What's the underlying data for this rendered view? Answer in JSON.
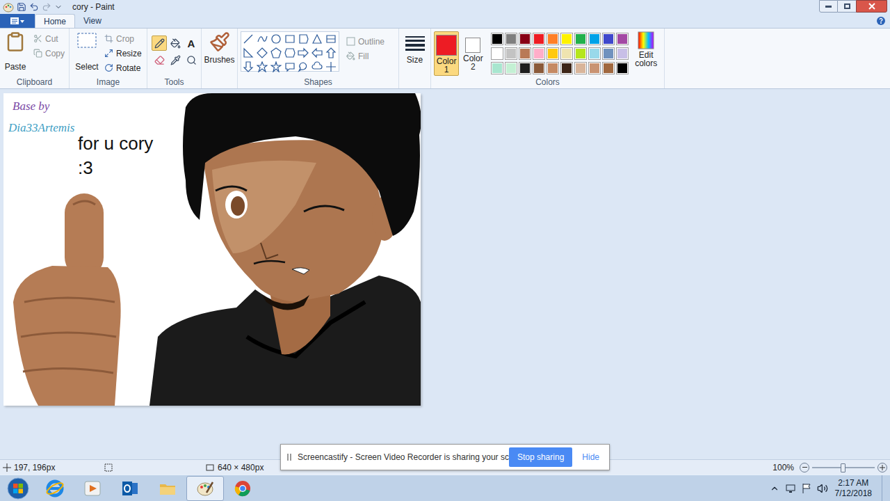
{
  "window": {
    "title": "cory - Paint"
  },
  "tabs": [
    {
      "label": "Home",
      "selected": true
    },
    {
      "label": "View",
      "selected": false
    }
  ],
  "ribbon": {
    "clipboard": {
      "label": "Clipboard",
      "paste": {
        "label": "Paste",
        "disabled": false
      },
      "cut": {
        "label": "Cut",
        "disabled": true
      },
      "copy": {
        "label": "Copy",
        "disabled": true
      }
    },
    "image": {
      "label": "Image",
      "select": {
        "label": "Select",
        "disabled": false
      },
      "crop": {
        "label": "Crop",
        "disabled": true
      },
      "resize": {
        "label": "Resize",
        "disabled": false
      },
      "rotate": {
        "label": "Rotate",
        "disabled": false
      }
    },
    "tools": {
      "label": "Tools",
      "items": [
        {
          "kind": "pencil",
          "selected": true
        },
        {
          "kind": "fill",
          "selected": false
        },
        {
          "kind": "text",
          "glyph": "A",
          "selected": false
        },
        {
          "kind": "eraser",
          "selected": false
        },
        {
          "kind": "picker",
          "selected": false
        },
        {
          "kind": "magnifier",
          "selected": false
        }
      ]
    },
    "brushes": {
      "label": "Brushes"
    },
    "shapes": {
      "label": "Shapes",
      "outline": {
        "label": "Outline",
        "disabled": true
      },
      "fill": {
        "label": "Fill",
        "disabled": true
      }
    },
    "size": {
      "label": "Size"
    },
    "color1": {
      "label": "Color 1",
      "color": "#ed1c24",
      "selected": true
    },
    "color2": {
      "label": "Color 2",
      "color": "#ffffff",
      "selected": false
    },
    "colors": {
      "label": "Colors",
      "swatches": [
        {
          "color": "#000000"
        },
        {
          "color": "#7f7f7f"
        },
        {
          "color": "#880015"
        },
        {
          "color": "#ed1c24"
        },
        {
          "color": "#ff7f27"
        },
        {
          "color": "#fff200"
        },
        {
          "color": "#22b14c"
        },
        {
          "color": "#00a2e8"
        },
        {
          "color": "#3f48cc"
        },
        {
          "color": "#a349a4"
        },
        {
          "color": "#ffffff"
        },
        {
          "color": "#c3c3c3"
        },
        {
          "color": "#b97a57"
        },
        {
          "color": "#ffaec9"
        },
        {
          "color": "#ffc90e"
        },
        {
          "color": "#efe4b0"
        },
        {
          "color": "#b5e61d"
        },
        {
          "color": "#99d9ea"
        },
        {
          "color": "#7092be"
        },
        {
          "color": "#c8bfe7"
        },
        {
          "color": "#a8e6cf"
        },
        {
          "color": "#c4f0d4"
        },
        {
          "color": "#1e1e1e"
        },
        {
          "color": "#8a5a3a"
        },
        {
          "color": "#c58a63"
        },
        {
          "color": "#3d2618"
        },
        {
          "color": "#d9b59a"
        },
        {
          "color": "#c99372"
        },
        {
          "color": "#a0683f"
        },
        {
          "color": "#000000"
        }
      ]
    },
    "edit_colors": {
      "label": "Edit colors"
    }
  },
  "canvas": {
    "texts": [
      {
        "text": "Base by",
        "kind": "script",
        "color": "#7b4aa6"
      },
      {
        "text": "Dia33Artemis",
        "kind": "script",
        "color": "#3d9ec4"
      },
      {
        "text": "for u cory",
        "kind": "plain",
        "color": "#111111"
      },
      {
        "text": ":3",
        "kind": "plain",
        "color": "#111111"
      }
    ]
  },
  "screencastify": {
    "message": "Screencastify - Screen Video Recorder is sharing your screen.",
    "stop": "Stop sharing",
    "hide": "Hide"
  },
  "status_bar": {
    "cursor": "197, 196px",
    "size": "640 × 480px",
    "zoom": "100%",
    "zoom_level": 0.5
  },
  "taskbar": {
    "apps": [
      {
        "kind": "ie",
        "selected": false
      },
      {
        "kind": "media",
        "selected": false
      },
      {
        "kind": "outlook",
        "selected": false
      },
      {
        "kind": "explorer",
        "selected": false
      },
      {
        "kind": "paint",
        "selected": true
      },
      {
        "kind": "chrome",
        "selected": false
      }
    ],
    "clock": {
      "time": "2:17 AM",
      "date": "7/12/2018"
    }
  }
}
